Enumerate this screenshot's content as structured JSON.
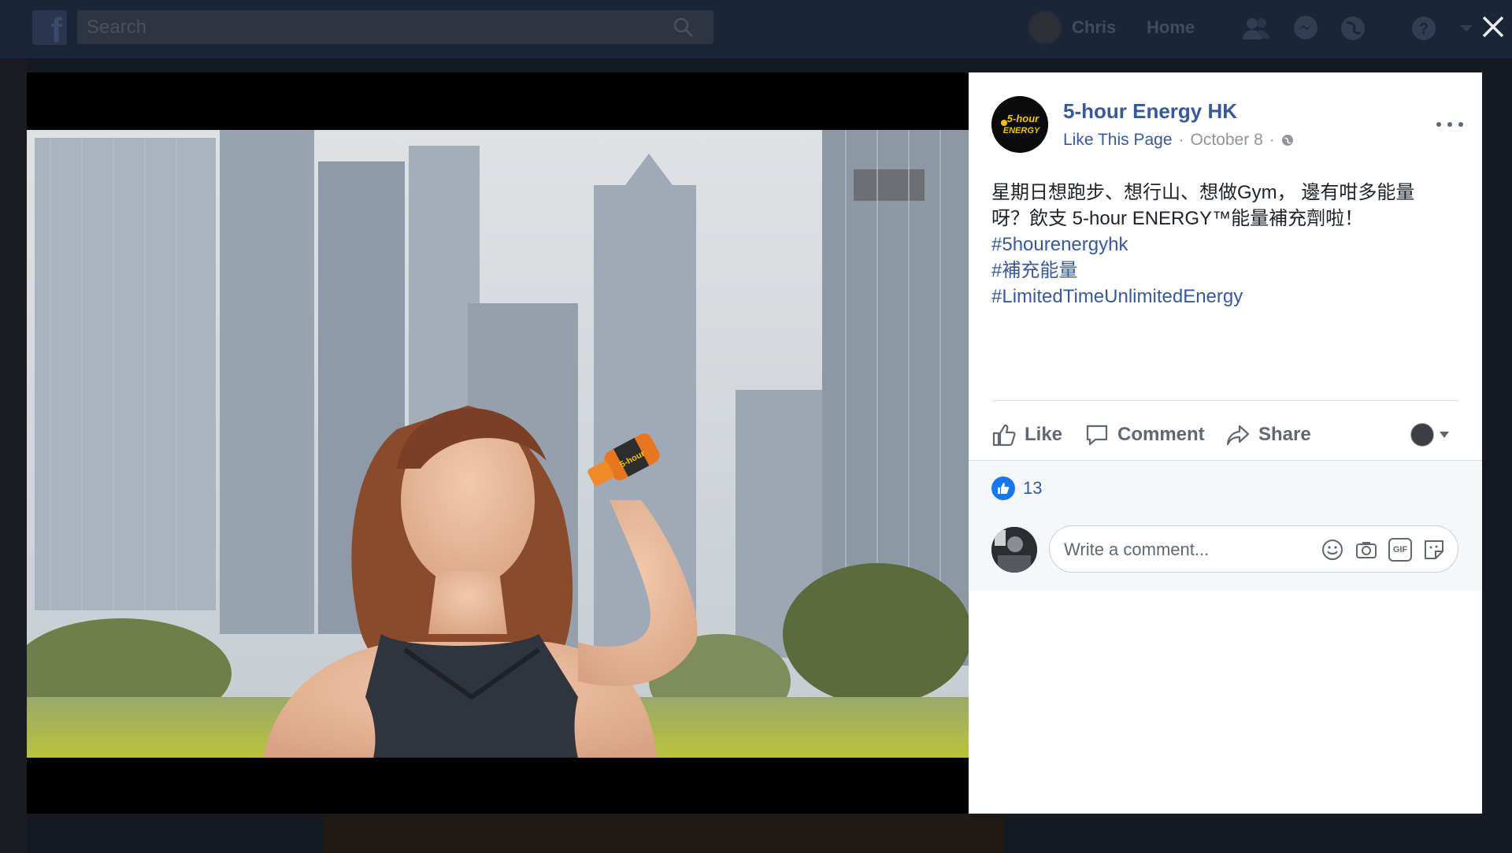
{
  "topbar": {
    "search_placeholder": "Search",
    "user_name": "Chris",
    "home_label": "Home"
  },
  "post": {
    "page_name": "5-hour Energy HK",
    "like_page_label": "Like This Page",
    "separator": "·",
    "date": "October 8",
    "text_line1": "星期日想跑步、想行山、想做Gym， 邊有咁多能量",
    "text_line2": "呀？飲支 5-hour ENERGY™能量補充劑啦！",
    "hashtags": [
      "#5hourenergyhk",
      "#補充能量",
      "#LimitedTimeUnlimitedEnergy"
    ],
    "logo_text": "5-hour ENERGY"
  },
  "actions": {
    "like_label": "Like",
    "comment_label": "Comment",
    "share_label": "Share"
  },
  "reactions": {
    "count": "13"
  },
  "comment": {
    "placeholder": "Write a comment...",
    "gif_label": "GIF"
  },
  "colors": {
    "link_blue": "#385898",
    "like_blue": "#1877f2",
    "muted_gray": "#606770",
    "brand_yellow": "#f2c400"
  }
}
